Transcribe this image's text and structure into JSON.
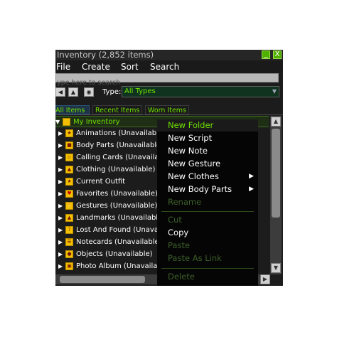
{
  "window": {
    "title": "Inventory (2,852 items)",
    "minimize_glyph": "_",
    "close_glyph": "X"
  },
  "menubar": [
    "File",
    "Create",
    "Sort",
    "Search"
  ],
  "search": {
    "placeholder": "ype here to search"
  },
  "type_filter": {
    "label": "Type:",
    "value": "All Types"
  },
  "tabs": [
    "All Items",
    "Recent Items",
    "Worn Items"
  ],
  "tree": {
    "root": "My Inventory",
    "items": [
      {
        "label": "Animations (Unavailable)",
        "icon": "animation-icon"
      },
      {
        "label": "Body Parts (Unavailable)",
        "icon": "body-parts-icon"
      },
      {
        "label": "Calling Cards (Unavailab",
        "icon": "calling-card-icon"
      },
      {
        "label": "Clothing (Unavailable)",
        "icon": "clothing-icon"
      },
      {
        "label": "Current Outfit",
        "icon": "outfit-icon"
      },
      {
        "label": "Favorites (Unavailable)",
        "icon": "heart-icon"
      },
      {
        "label": "Gestures (Unavailable)",
        "icon": "gesture-icon"
      },
      {
        "label": "Landmarks (Unavailable)",
        "icon": "landmark-icon"
      },
      {
        "label": "Lost And Found (Unava",
        "icon": "lost-found-icon"
      },
      {
        "label": "Notecards (Unavailable)",
        "icon": "notecard-icon"
      },
      {
        "label": "Objects (Unavailable)",
        "icon": "object-icon"
      },
      {
        "label": "Photo Album (Unavailabl",
        "icon": "photo-icon"
      }
    ]
  },
  "context_menu": {
    "items": [
      {
        "label": "New Folder",
        "state": "highlighted"
      },
      {
        "label": "New Script",
        "state": "enabled"
      },
      {
        "label": "New Note",
        "state": "enabled"
      },
      {
        "label": "New Gesture",
        "state": "enabled"
      },
      {
        "label": "New Clothes",
        "state": "enabled",
        "submenu": true
      },
      {
        "label": "New Body Parts",
        "state": "enabled",
        "submenu": true
      },
      {
        "label": "Rename",
        "state": "disabled"
      },
      {
        "label": "Cut",
        "state": "disabled"
      },
      {
        "label": "Copy",
        "state": "enabled"
      },
      {
        "label": "Paste",
        "state": "disabled"
      },
      {
        "label": "Paste As Link",
        "state": "disabled"
      },
      {
        "label": "Delete",
        "state": "disabled"
      }
    ]
  },
  "colors": {
    "accent_green": "#6ee000",
    "window_bg": "#1c1c1c",
    "menu_bg": "#050505",
    "disabled_text": "#3d5f2a"
  }
}
